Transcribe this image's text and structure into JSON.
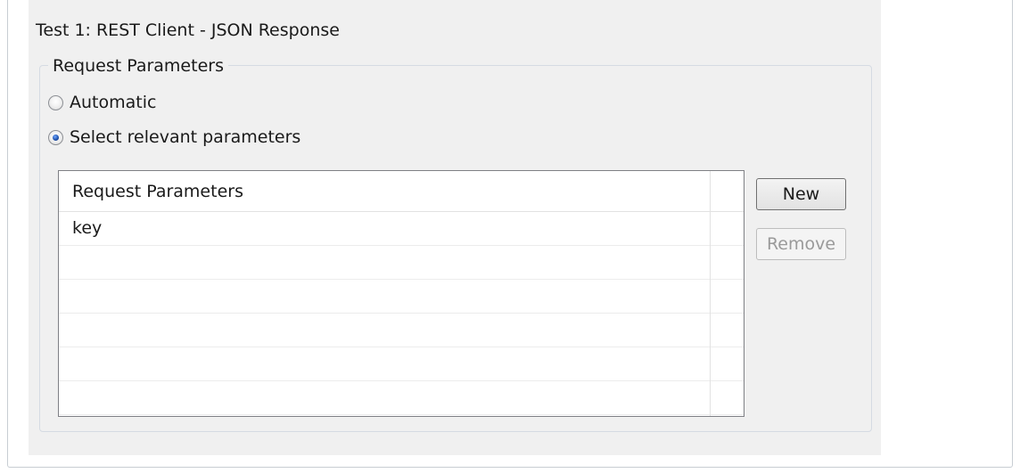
{
  "section_title": "Test 1: REST Client - JSON Response",
  "request_parameters_group": {
    "legend": "Request Parameters",
    "options": [
      {
        "label": "Automatic",
        "selected": false
      },
      {
        "label": "Select relevant parameters",
        "selected": true
      }
    ],
    "table": {
      "header": "Request Parameters",
      "rows": [
        "key",
        "",
        "",
        "",
        "",
        ""
      ]
    },
    "buttons": {
      "new_label": "New",
      "remove_label": "Remove",
      "remove_enabled": false
    }
  }
}
